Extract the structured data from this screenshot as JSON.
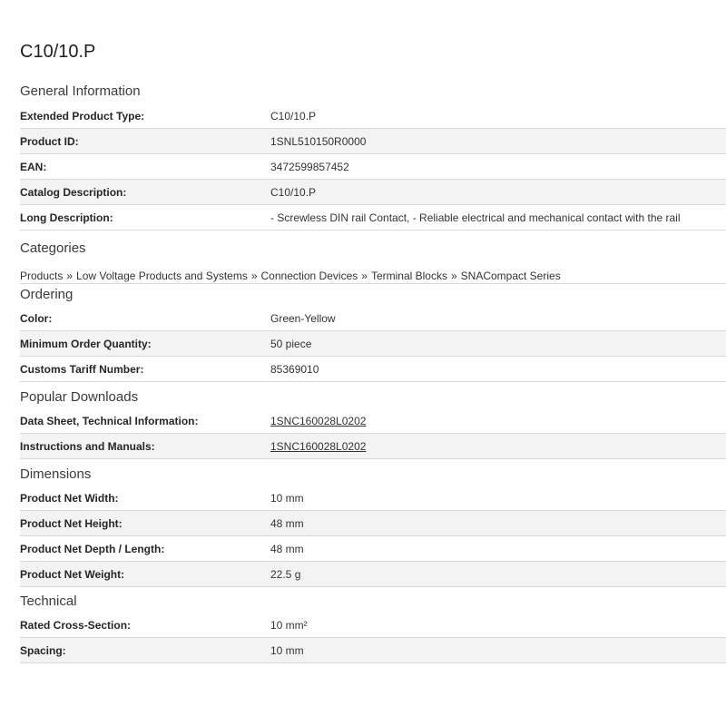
{
  "title": "C10/10.P",
  "general": {
    "heading": "General Information",
    "rows": [
      {
        "label": "Extended Product Type:",
        "value": "C10/10.P"
      },
      {
        "label": "Product ID:",
        "value": "1SNL510150R0000"
      },
      {
        "label": "EAN:",
        "value": "3472599857452"
      },
      {
        "label": "Catalog Description:",
        "value": "C10/10.P"
      },
      {
        "label": "Long Description:",
        "value": "- Screwless DIN rail Contact, - Reliable electrical and mechanical contact with the rail"
      }
    ]
  },
  "categories": {
    "heading": "Categories",
    "separator": "»",
    "crumbs": [
      "Products",
      "Low Voltage Products and Systems",
      "Connection Devices",
      "Terminal Blocks",
      "SNACompact Series"
    ]
  },
  "ordering": {
    "heading": "Ordering",
    "rows": [
      {
        "label": "Color:",
        "value": "Green-Yellow"
      },
      {
        "label": "Minimum Order Quantity:",
        "value": "50 piece"
      },
      {
        "label": "Customs Tariff Number:",
        "value": "85369010"
      }
    ]
  },
  "downloads": {
    "heading": "Popular Downloads",
    "rows": [
      {
        "label": "Data Sheet, Technical Information:",
        "value": "1SNC160028L0202"
      },
      {
        "label": "Instructions and Manuals:",
        "value": "1SNC160028L0202"
      }
    ]
  },
  "dimensions": {
    "heading": "Dimensions",
    "rows": [
      {
        "label": "Product Net Width:",
        "value": "10 mm"
      },
      {
        "label": "Product Net Height:",
        "value": "48 mm"
      },
      {
        "label": "Product Net Depth / Length:",
        "value": "48 mm"
      },
      {
        "label": "Product Net Weight:",
        "value": "22.5 g"
      }
    ]
  },
  "technical": {
    "heading": "Technical",
    "rows": [
      {
        "label": "Rated Cross-Section:",
        "value": "10 mm²"
      },
      {
        "label": "Spacing:",
        "value": "10 mm"
      }
    ]
  }
}
